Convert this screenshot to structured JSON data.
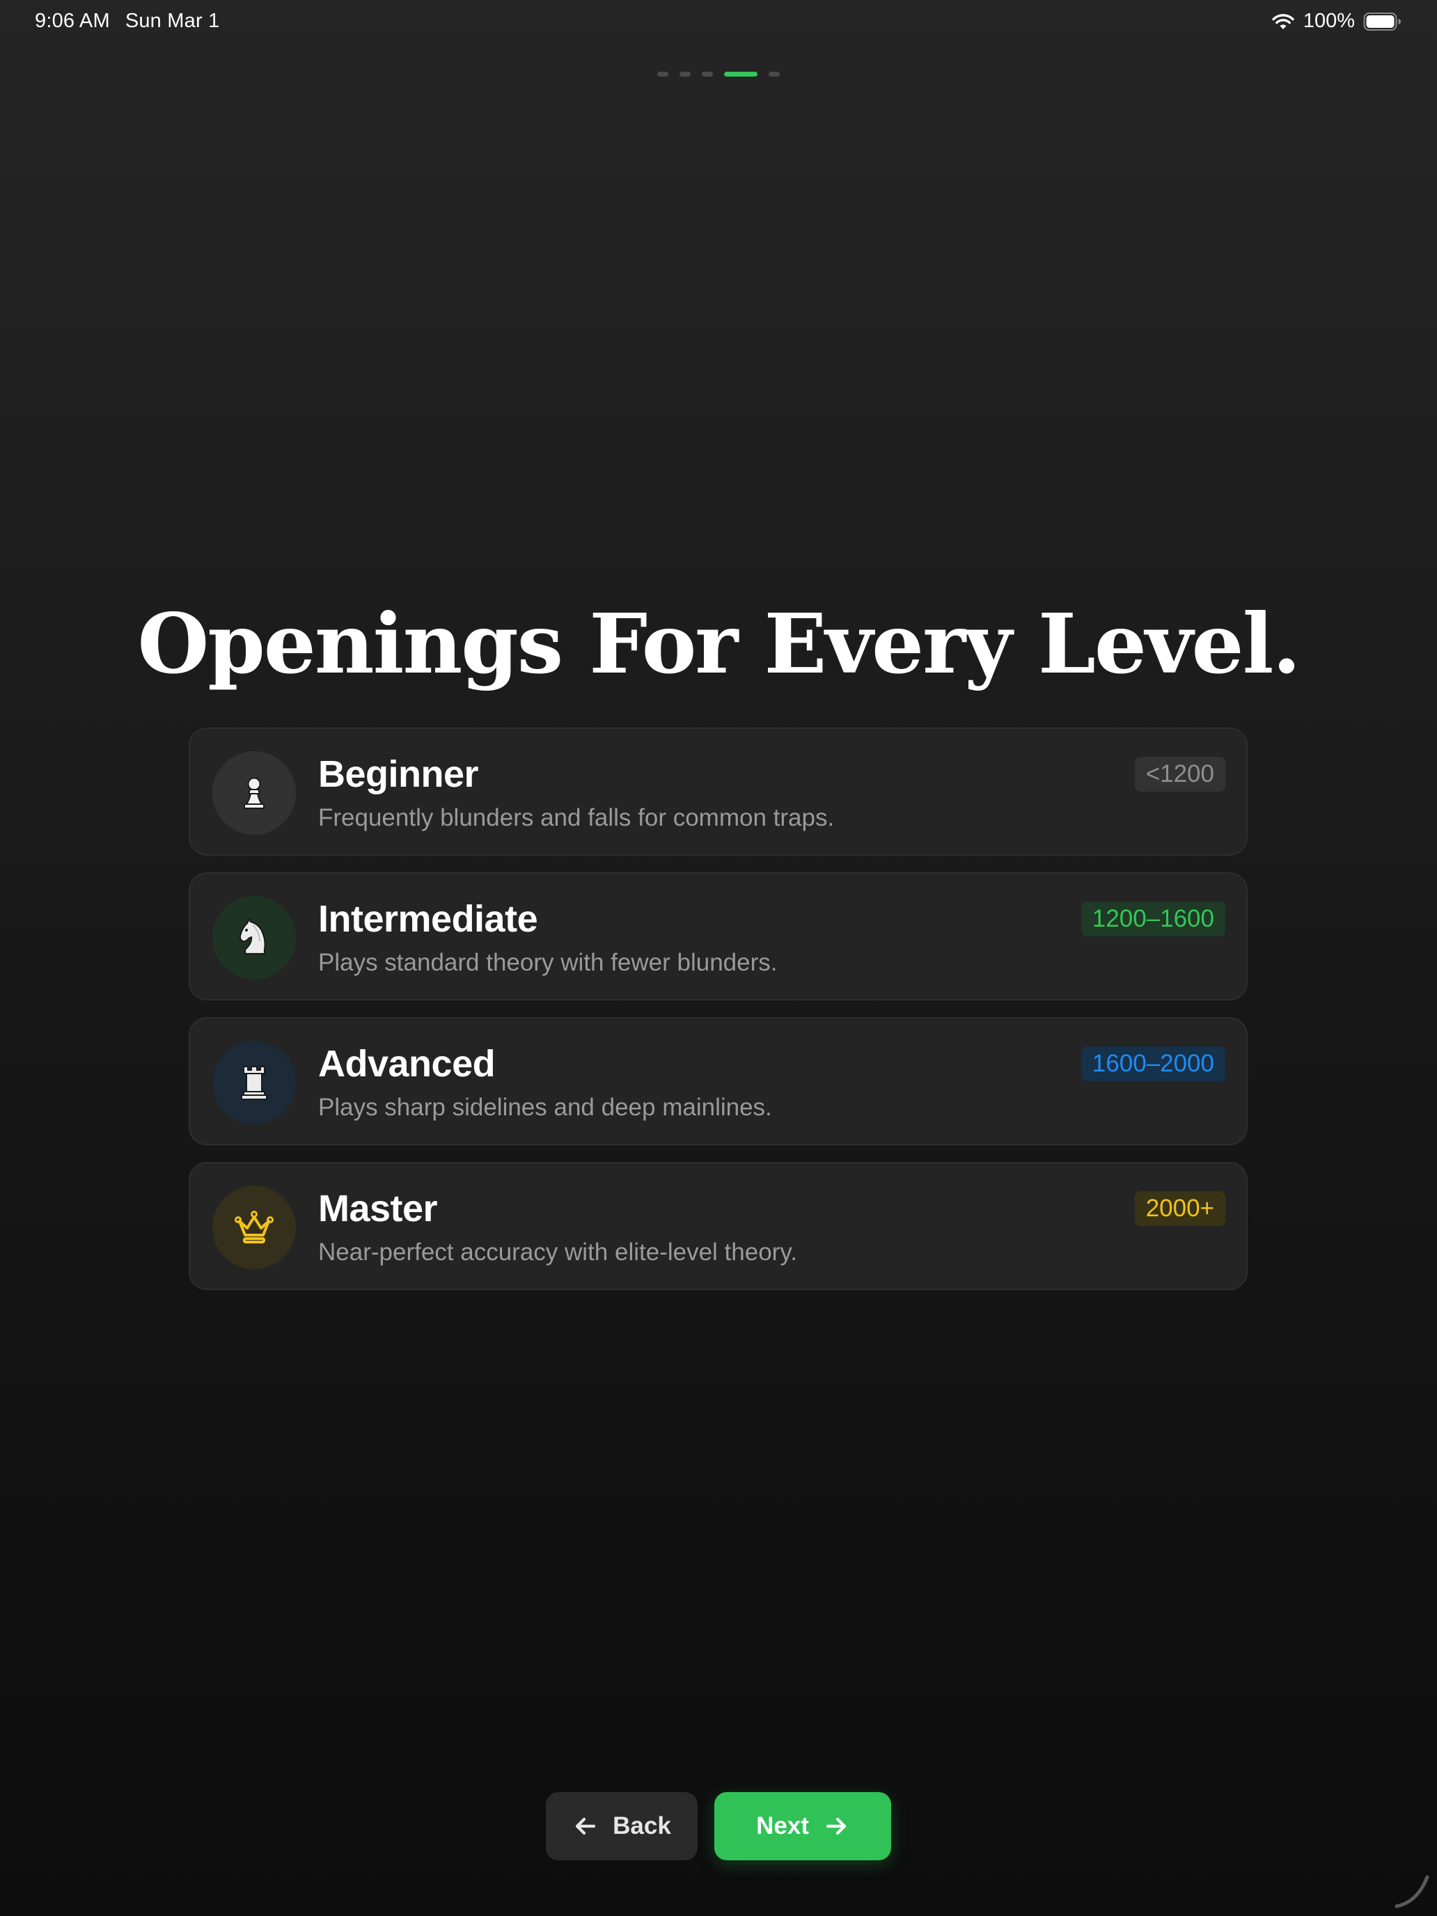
{
  "status_bar": {
    "time": "9:06 AM",
    "date": "Sun Mar 1",
    "battery_percent": "100%"
  },
  "pager": {
    "total_pages": 5,
    "current_page": 4
  },
  "title": "Openings For Every Level.",
  "levels": [
    {
      "name": "Beginner",
      "description": "Frequently blunders and falls for common traps.",
      "rating": "<1200",
      "icon": "pawn-icon",
      "accent": "#8f8f8f"
    },
    {
      "name": "Intermediate",
      "description": "Plays standard theory with fewer blunders.",
      "rating": "1200–1600",
      "icon": "knight-icon",
      "accent": "#34c759"
    },
    {
      "name": "Advanced",
      "description": "Plays sharp sidelines and deep mainlines.",
      "rating": "1600–2000",
      "icon": "rook-icon",
      "accent": "#1f8cf0"
    },
    {
      "name": "Master",
      "description": "Near-perfect accuracy with elite-level theory.",
      "rating": "2000+",
      "icon": "crown-icon",
      "accent": "#f2c21a"
    }
  ],
  "buttons": {
    "back_label": "Back",
    "next_label": "Next"
  },
  "colors": {
    "primary": "#30c257",
    "background": "#1c1c1c",
    "card": "#242424"
  }
}
